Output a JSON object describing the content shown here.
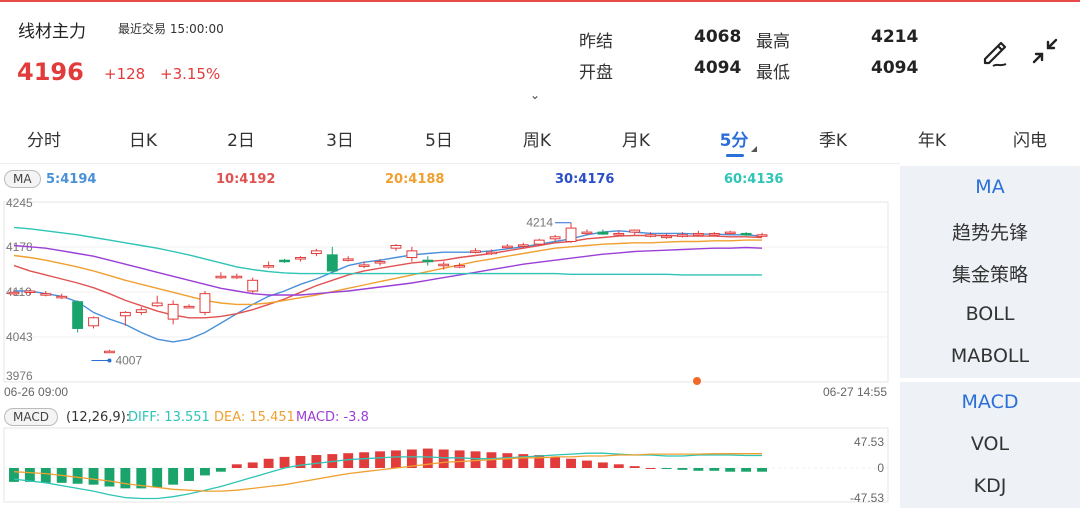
{
  "header": {
    "title": "线材主力",
    "last_trade": "最近交易 15:00:00",
    "price": "4196",
    "change": "+128",
    "change_pct": "+3.15%"
  },
  "quote": {
    "prev_settle_label": "昨结",
    "prev_settle": "4068",
    "open_label": "开盘",
    "open": "4094",
    "high_label": "最高",
    "high": "4214",
    "low_label": "最低",
    "low": "4094"
  },
  "toolbar_icons": [
    "draw-icon",
    "collapse-icon"
  ],
  "expand_glyph": "⌄",
  "tabs": [
    {
      "label": "分时",
      "active": false
    },
    {
      "label": "日K",
      "active": false
    },
    {
      "label": "2日",
      "active": false
    },
    {
      "label": "3日",
      "active": false
    },
    {
      "label": "5日",
      "active": false
    },
    {
      "label": "周K",
      "active": false
    },
    {
      "label": "月K",
      "active": false
    },
    {
      "label": "5分",
      "active": true
    },
    {
      "label": "季K",
      "active": false
    },
    {
      "label": "年K",
      "active": false
    },
    {
      "label": "闪电",
      "active": false
    }
  ],
  "ma_legend": {
    "badge": "MA",
    "items": [
      {
        "text": "5:4194",
        "color": "#4a90d9"
      },
      {
        "text": "10:4192",
        "color": "#e05252"
      },
      {
        "text": "20:4188",
        "color": "#f0a030"
      },
      {
        "text": "30:4176",
        "color": "#2a4fc8"
      },
      {
        "text": "60:4136",
        "color": "#2ec4b6"
      }
    ]
  },
  "price_axis": [
    "4245",
    "4178",
    "4110",
    "4043",
    "3976"
  ],
  "time_axis": {
    "start": "06-26 09:00",
    "end": "06-27 14:55"
  },
  "annotations": {
    "high": "4214",
    "low": "4007"
  },
  "macd_legend": {
    "badge": "MACD",
    "params": "(12,26,9):",
    "diff": "DIFF: 13.551",
    "dea": "DEA: 15.451",
    "macd": "MACD: -3.8",
    "diff_color": "#2ec4b6",
    "dea_color": "#f0a030",
    "macd_color": "#9b3fd6"
  },
  "macd_axis": [
    "47.53",
    "0",
    "-47.53"
  ],
  "colors": {
    "up": "#e23b3b",
    "down": "#1aa36b",
    "accent": "#2a6fd8"
  },
  "panel_main": [
    {
      "label": "MA",
      "active": true
    },
    {
      "label": "趋势先锋",
      "active": false
    },
    {
      "label": "集金策略",
      "active": false
    },
    {
      "label": "BOLL",
      "active": false
    },
    {
      "label": "MABOLL",
      "active": false
    }
  ],
  "panel_sub": [
    {
      "label": "MACD",
      "active": true
    },
    {
      "label": "VOL",
      "active": false
    },
    {
      "label": "KDJ",
      "active": false
    }
  ],
  "chart_data": {
    "type": "candlestick",
    "ylim": [
      3976,
      4245
    ],
    "candles": [
      {
        "o": 4110,
        "h": 4114,
        "l": 4106,
        "c": 4110
      },
      {
        "o": 4110,
        "h": 4114,
        "l": 4106,
        "c": 4112
      },
      {
        "o": 4108,
        "h": 4112,
        "l": 4104,
        "c": 4108
      },
      {
        "o": 4104,
        "h": 4108,
        "l": 4100,
        "c": 4104
      },
      {
        "o": 4096,
        "h": 4098,
        "l": 4050,
        "c": 4056
      },
      {
        "o": 4060,
        "h": 4074,
        "l": 4056,
        "c": 4072
      },
      {
        "o": 4022,
        "h": 4024,
        "l": 4020,
        "c": 4022
      },
      {
        "o": 4075,
        "h": 4082,
        "l": 4060,
        "c": 4080
      },
      {
        "o": 4080,
        "h": 4088,
        "l": 4076,
        "c": 4084
      },
      {
        "o": 4090,
        "h": 4105,
        "l": 4088,
        "c": 4094
      },
      {
        "o": 4070,
        "h": 4098,
        "l": 4062,
        "c": 4092
      },
      {
        "o": 4088,
        "h": 4092,
        "l": 4086,
        "c": 4089
      },
      {
        "o": 4080,
        "h": 4112,
        "l": 4076,
        "c": 4108
      },
      {
        "o": 4134,
        "h": 4140,
        "l": 4130,
        "c": 4134
      },
      {
        "o": 4134,
        "h": 4138,
        "l": 4130,
        "c": 4134
      },
      {
        "o": 4112,
        "h": 4132,
        "l": 4108,
        "c": 4128
      },
      {
        "o": 4150,
        "h": 4156,
        "l": 4146,
        "c": 4150
      },
      {
        "o": 4158,
        "h": 4160,
        "l": 4154,
        "c": 4156
      },
      {
        "o": 4160,
        "h": 4164,
        "l": 4156,
        "c": 4162
      },
      {
        "o": 4168,
        "h": 4175,
        "l": 4164,
        "c": 4172
      },
      {
        "o": 4166,
        "h": 4178,
        "l": 4140,
        "c": 4142
      },
      {
        "o": 4160,
        "h": 4164,
        "l": 4156,
        "c": 4160
      },
      {
        "o": 4150,
        "h": 4156,
        "l": 4146,
        "c": 4151
      },
      {
        "o": 4155,
        "h": 4160,
        "l": 4150,
        "c": 4156
      },
      {
        "o": 4176,
        "h": 4182,
        "l": 4172,
        "c": 4180
      },
      {
        "o": 4162,
        "h": 4178,
        "l": 4156,
        "c": 4172
      },
      {
        "o": 4158,
        "h": 4164,
        "l": 4150,
        "c": 4156
      },
      {
        "o": 4150,
        "h": 4156,
        "l": 4144,
        "c": 4152
      },
      {
        "o": 4150,
        "h": 4154,
        "l": 4146,
        "c": 4150
      },
      {
        "o": 4172,
        "h": 4176,
        "l": 4168,
        "c": 4172
      },
      {
        "o": 4170,
        "h": 4174,
        "l": 4166,
        "c": 4170
      },
      {
        "o": 4178,
        "h": 4182,
        "l": 4175,
        "c": 4179
      },
      {
        "o": 4179,
        "h": 4184,
        "l": 4176,
        "c": 4181
      },
      {
        "o": 4182,
        "h": 4190,
        "l": 4180,
        "c": 4188
      },
      {
        "o": 4190,
        "h": 4196,
        "l": 4186,
        "c": 4193
      },
      {
        "o": 4186,
        "h": 4214,
        "l": 4184,
        "c": 4206
      },
      {
        "o": 4200,
        "h": 4204,
        "l": 4196,
        "c": 4200
      },
      {
        "o": 4200,
        "h": 4204,
        "l": 4196,
        "c": 4197
      },
      {
        "o": 4198,
        "h": 4202,
        "l": 4194,
        "c": 4198
      },
      {
        "o": 4200,
        "h": 4204,
        "l": 4196,
        "c": 4203
      },
      {
        "o": 4196,
        "h": 4200,
        "l": 4192,
        "c": 4196
      },
      {
        "o": 4194,
        "h": 4198,
        "l": 4190,
        "c": 4194
      },
      {
        "o": 4196,
        "h": 4200,
        "l": 4192,
        "c": 4196
      },
      {
        "o": 4198,
        "h": 4202,
        "l": 4194,
        "c": 4198
      },
      {
        "o": 4196,
        "h": 4200,
        "l": 4194,
        "c": 4198
      },
      {
        "o": 4199,
        "h": 4202,
        "l": 4196,
        "c": 4200
      },
      {
        "o": 4198,
        "h": 4200,
        "l": 4194,
        "c": 4196
      },
      {
        "o": 4196,
        "h": 4199,
        "l": 4193,
        "c": 4196
      }
    ],
    "ma_lines": [
      {
        "name": "5",
        "color": "#4a90d9",
        "values": [
          4112,
          4112,
          4108,
          4104,
          4096,
          4080,
          4070,
          4062,
          4050,
          4040,
          4036,
          4040,
          4050,
          4064,
          4078,
          4092,
          4104,
          4112,
          4122,
          4130,
          4140,
          4150,
          4155,
          4158,
          4162,
          4166,
          4168,
          4170,
          4170,
          4170,
          4172,
          4175,
          4178,
          4182,
          4186,
          4190,
          4196,
          4200,
          4202,
          4200,
          4198,
          4198,
          4198,
          4197,
          4197,
          4196,
          4196,
          4194
        ]
      },
      {
        "name": "10",
        "color": "#e05252",
        "values": [
          4150,
          4142,
          4136,
          4130,
          4124,
          4117,
          4108,
          4098,
          4090,
          4082,
          4076,
          4072,
          4072,
          4074,
          4078,
          4084,
          4092,
          4100,
          4110,
          4120,
          4128,
          4136,
          4142,
          4146,
          4150,
          4154,
          4156,
          4158,
          4162,
          4165,
          4168,
          4172,
          4176,
          4180,
          4184,
          4186,
          4190,
          4192,
          4194,
          4195,
          4195,
          4195,
          4194,
          4194,
          4194,
          4193,
          4193,
          4192
        ]
      },
      {
        "name": "20",
        "color": "#f0a030",
        "values": [
          4165,
          4162,
          4158,
          4153,
          4148,
          4142,
          4135,
          4128,
          4122,
          4116,
          4110,
          4104,
          4098,
          4094,
          4092,
          4092,
          4094,
          4098,
          4102,
          4106,
          4111,
          4116,
          4121,
          4126,
          4131,
          4136,
          4141,
          4146,
          4151,
          4156,
          4160,
          4164,
          4168,
          4172,
          4176,
          4178,
          4180,
          4182,
          4183,
          4184,
          4184,
          4185,
          4186,
          4186,
          4187,
          4187,
          4188,
          4188
        ]
      },
      {
        "name": "30",
        "color": "#9b3fd6",
        "values": [
          4180,
          4178,
          4176,
          4172,
          4168,
          4164,
          4158,
          4152,
          4146,
          4140,
          4134,
          4128,
          4122,
          4116,
          4112,
          4108,
          4106,
          4106,
          4106,
          4108,
          4110,
          4112,
          4115,
          4118,
          4121,
          4124,
          4128,
          4132,
          4136,
          4140,
          4144,
          4148,
          4152,
          4155,
          4158,
          4161,
          4164,
          4167,
          4169,
          4171,
          4172,
          4173,
          4174,
          4175,
          4176,
          4176,
          4177,
          4176
        ]
      },
      {
        "name": "60",
        "color": "#2ec4b6",
        "values": [
          4207,
          4205,
          4202,
          4199,
          4196,
          4192,
          4188,
          4184,
          4180,
          4176,
          4171,
          4166,
          4160,
          4154,
          4148,
          4144,
          4141,
          4139,
          4138,
          4138,
          4138,
          4138,
          4138,
          4138,
          4138,
          4138,
          4138,
          4138,
          4138,
          4138,
          4138,
          4138,
          4138,
          4138,
          4138,
          4137,
          4137,
          4137,
          4137,
          4137,
          4137,
          4137,
          4136,
          4136,
          4136,
          4136,
          4136,
          4136
        ]
      }
    ],
    "macd_hist": [
      -15,
      -15,
      -16,
      -16,
      -17,
      -18,
      -20,
      -22,
      -22,
      -21,
      -18,
      -14,
      -8,
      -4,
      4,
      6,
      10,
      12,
      13,
      14,
      15,
      16,
      17,
      18,
      19,
      20,
      21,
      20,
      19,
      18,
      17,
      16,
      15,
      14,
      12,
      10,
      8,
      6,
      4,
      2,
      0,
      -1,
      -2,
      -3,
      -3,
      -4,
      -4,
      -4
    ],
    "macd_diff": [
      -12,
      -14,
      -16,
      -19,
      -22,
      -25,
      -29,
      -32,
      -33,
      -33,
      -31,
      -28,
      -24,
      -20,
      -15,
      -10,
      -5,
      0,
      3,
      5,
      7,
      9,
      10,
      11,
      12,
      12,
      12,
      11,
      11,
      10,
      10,
      11,
      12,
      13,
      14,
      15,
      16,
      16,
      15,
      14,
      14,
      13,
      13,
      14,
      14,
      14,
      13.5,
      13.5
    ],
    "macd_dea": [
      -4,
      -5,
      -6,
      -8,
      -10,
      -12,
      -14,
      -17,
      -19,
      -21,
      -23,
      -24,
      -25,
      -25,
      -24,
      -22,
      -20,
      -18,
      -15,
      -12,
      -9,
      -6,
      -4,
      -2,
      0,
      2,
      4,
      6,
      7,
      8,
      9,
      10,
      11,
      11,
      12,
      12,
      13,
      13,
      14,
      14,
      15,
      15,
      15,
      15,
      15.5,
      15.5,
      15.5,
      15.5
    ],
    "macd_ylim": [
      -47.53,
      47.53
    ]
  }
}
